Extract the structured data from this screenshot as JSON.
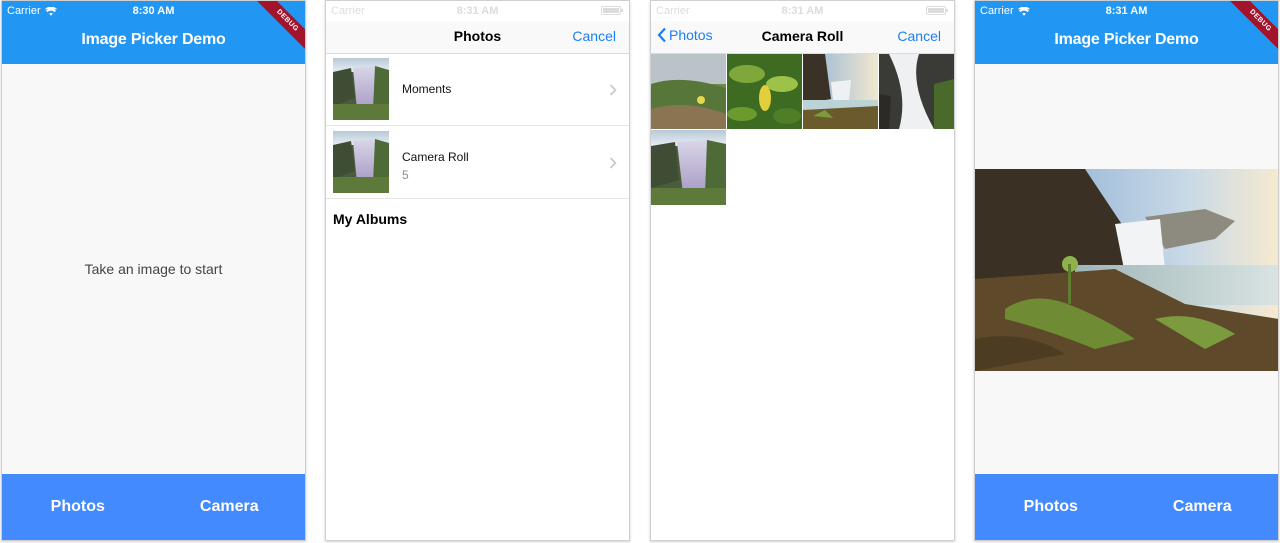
{
  "screen1": {
    "status": {
      "carrier": "Carrier",
      "time": "8:30 AM"
    },
    "title": "Image Picker Demo",
    "debug": "DEBUG",
    "empty_message": "Take an image to start",
    "buttons": {
      "photos": "Photos",
      "camera": "Camera"
    }
  },
  "screen2": {
    "status": {
      "carrier": "Carrier",
      "time": "8:31 AM"
    },
    "nav_title": "Photos",
    "cancel": "Cancel",
    "albums": [
      {
        "label": "Moments",
        "count": ""
      },
      {
        "label": "Camera Roll",
        "count": "5"
      }
    ],
    "section": "My Albums"
  },
  "screen3": {
    "status": {
      "carrier": "Carrier",
      "time": "8:31 AM"
    },
    "back": "Photos",
    "nav_title": "Camera Roll",
    "cancel": "Cancel",
    "photo_count": 5
  },
  "screen4": {
    "status": {
      "carrier": "Carrier",
      "time": "8:31 AM"
    },
    "title": "Image Picker Demo",
    "debug": "DEBUG",
    "buttons": {
      "photos": "Photos",
      "camera": "Camera"
    }
  },
  "colors": {
    "app_bar": "#2196f3",
    "bottom_bar": "#448aff",
    "ios_tint": "#1a7ef7",
    "debug_banner": "#a3142b"
  },
  "icons": [
    "wifi-icon",
    "battery-icon",
    "chevron-right-icon",
    "chevron-left-icon"
  ]
}
